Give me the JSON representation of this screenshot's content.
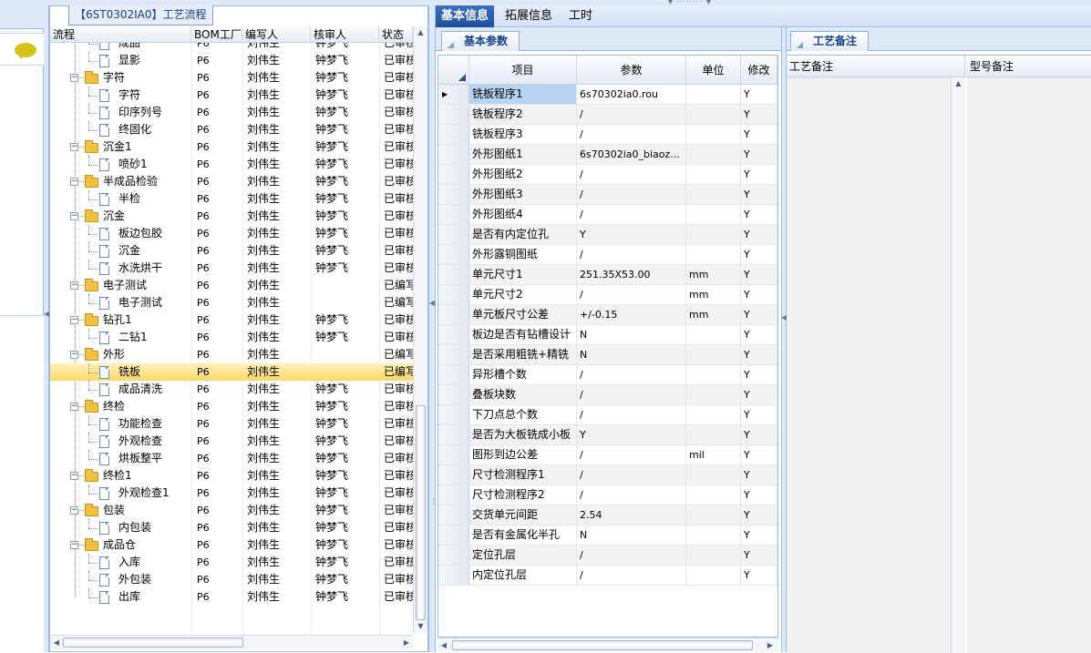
{
  "tree": {
    "title": "【6ST0302IA0】工艺流程",
    "columns": [
      "流程",
      "BOM工厂",
      "编写人",
      "核审人",
      "状态"
    ],
    "rows": [
      {
        "name": "成品",
        "type": "doc",
        "depth": 2,
        "bom": "P6",
        "writer": "刘伟生",
        "reviewer": "钟梦飞",
        "status": "已审核"
      },
      {
        "name": "显影",
        "type": "doc",
        "depth": 2,
        "bom": "P6",
        "writer": "刘伟生",
        "reviewer": "钟梦飞",
        "status": "已审核"
      },
      {
        "name": "字符",
        "type": "folder",
        "depth": 1,
        "bom": "P6",
        "writer": "刘伟生",
        "reviewer": "钟梦飞",
        "status": "已审核"
      },
      {
        "name": "字符",
        "type": "doc",
        "depth": 2,
        "bom": "P6",
        "writer": "刘伟生",
        "reviewer": "钟梦飞",
        "status": "已审核"
      },
      {
        "name": "印序列号",
        "type": "doc",
        "depth": 2,
        "bom": "P6",
        "writer": "刘伟生",
        "reviewer": "钟梦飞",
        "status": "已审核"
      },
      {
        "name": "终固化",
        "type": "doc",
        "depth": 2,
        "bom": "P6",
        "writer": "刘伟生",
        "reviewer": "钟梦飞",
        "status": "已审核"
      },
      {
        "name": "沉金1",
        "type": "folder",
        "depth": 1,
        "bom": "P6",
        "writer": "刘伟生",
        "reviewer": "钟梦飞",
        "status": "已审核"
      },
      {
        "name": "喷砂1",
        "type": "doc",
        "depth": 2,
        "bom": "P6",
        "writer": "刘伟生",
        "reviewer": "钟梦飞",
        "status": "已审核"
      },
      {
        "name": "半成品检验",
        "type": "folder",
        "depth": 1,
        "bom": "P6",
        "writer": "刘伟生",
        "reviewer": "钟梦飞",
        "status": "已审核"
      },
      {
        "name": "半检",
        "type": "doc",
        "depth": 2,
        "bom": "P6",
        "writer": "刘伟生",
        "reviewer": "钟梦飞",
        "status": "已审核"
      },
      {
        "name": "沉金",
        "type": "folder",
        "depth": 1,
        "bom": "P6",
        "writer": "刘伟生",
        "reviewer": "钟梦飞",
        "status": "已审核"
      },
      {
        "name": "板边包胶",
        "type": "doc",
        "depth": 2,
        "bom": "P6",
        "writer": "刘伟生",
        "reviewer": "钟梦飞",
        "status": "已审核"
      },
      {
        "name": "沉金",
        "type": "doc",
        "depth": 2,
        "bom": "P6",
        "writer": "刘伟生",
        "reviewer": "钟梦飞",
        "status": "已审核"
      },
      {
        "name": "水洗烘干",
        "type": "doc",
        "depth": 2,
        "bom": "P6",
        "writer": "刘伟生",
        "reviewer": "钟梦飞",
        "status": "已审核"
      },
      {
        "name": "电子测试",
        "type": "folder",
        "depth": 1,
        "bom": "P6",
        "writer": "刘伟生",
        "reviewer": "",
        "status": "已编写"
      },
      {
        "name": "电子测试",
        "type": "doc",
        "depth": 2,
        "bom": "P6",
        "writer": "刘伟生",
        "reviewer": "",
        "status": "已编写"
      },
      {
        "name": "钻孔1",
        "type": "folder",
        "depth": 1,
        "bom": "P6",
        "writer": "刘伟生",
        "reviewer": "钟梦飞",
        "status": "已审核"
      },
      {
        "name": "二钻1",
        "type": "doc",
        "depth": 2,
        "bom": "P6",
        "writer": "刘伟生",
        "reviewer": "钟梦飞",
        "status": "已审核"
      },
      {
        "name": "外形",
        "type": "folder",
        "depth": 1,
        "bom": "P6",
        "writer": "刘伟生",
        "reviewer": "",
        "status": "已编写"
      },
      {
        "name": "铣板",
        "type": "doc",
        "depth": 2,
        "bom": "P6",
        "writer": "刘伟生",
        "reviewer": "",
        "status": "已编写",
        "selected": true
      },
      {
        "name": "成品清洗",
        "type": "doc",
        "depth": 2,
        "bom": "P6",
        "writer": "刘伟生",
        "reviewer": "钟梦飞",
        "status": "已审核"
      },
      {
        "name": "终检",
        "type": "folder",
        "depth": 1,
        "bom": "P6",
        "writer": "刘伟生",
        "reviewer": "钟梦飞",
        "status": "已审核"
      },
      {
        "name": "功能检查",
        "type": "doc",
        "depth": 2,
        "bom": "P6",
        "writer": "刘伟生",
        "reviewer": "钟梦飞",
        "status": "已审核"
      },
      {
        "name": "外观检查",
        "type": "doc",
        "depth": 2,
        "bom": "P6",
        "writer": "刘伟生",
        "reviewer": "钟梦飞",
        "status": "已审核"
      },
      {
        "name": "烘板整平",
        "type": "doc",
        "depth": 2,
        "bom": "P6",
        "writer": "刘伟生",
        "reviewer": "钟梦飞",
        "status": "已审核"
      },
      {
        "name": "终检1",
        "type": "folder",
        "depth": 1,
        "bom": "P6",
        "writer": "刘伟生",
        "reviewer": "钟梦飞",
        "status": "已审核"
      },
      {
        "name": "外观检查1",
        "type": "doc",
        "depth": 2,
        "bom": "P6",
        "writer": "刘伟生",
        "reviewer": "钟梦飞",
        "status": "已审核"
      },
      {
        "name": "包装",
        "type": "folder",
        "depth": 1,
        "bom": "P6",
        "writer": "刘伟生",
        "reviewer": "钟梦飞",
        "status": "已审核"
      },
      {
        "name": "内包装",
        "type": "doc",
        "depth": 2,
        "bom": "P6",
        "writer": "刘伟生",
        "reviewer": "钟梦飞",
        "status": "已审核"
      },
      {
        "name": "成品仓",
        "type": "folder",
        "depth": 1,
        "bom": "P6",
        "writer": "刘伟生",
        "reviewer": "钟梦飞",
        "status": "已审核"
      },
      {
        "name": "入库",
        "type": "doc",
        "depth": 2,
        "bom": "P6",
        "writer": "刘伟生",
        "reviewer": "钟梦飞",
        "status": "已审核"
      },
      {
        "name": "外包装",
        "type": "doc",
        "depth": 2,
        "bom": "P6",
        "writer": "刘伟生",
        "reviewer": "钟梦飞",
        "status": "已审核"
      },
      {
        "name": "出库",
        "type": "doc",
        "depth": 2,
        "bom": "P6",
        "writer": "刘伟生",
        "reviewer": "钟梦飞",
        "status": "已审核"
      }
    ]
  },
  "main_tabs": [
    "基本信息",
    "拓展信息",
    "工时"
  ],
  "params": {
    "tab_label": "基本参数",
    "columns": [
      "项目",
      "参数",
      "单位",
      "修改"
    ],
    "rows": [
      {
        "item": "铣板程序1",
        "value": "6s70302ia0.rou",
        "unit": "",
        "mod": "Y",
        "selected": true
      },
      {
        "item": "铣板程序2",
        "value": "/",
        "unit": "",
        "mod": "Y"
      },
      {
        "item": "铣板程序3",
        "value": "/",
        "unit": "",
        "mod": "Y"
      },
      {
        "item": "外形图纸1",
        "value": "6s70302ia0_biaoz...",
        "unit": "",
        "mod": "Y"
      },
      {
        "item": "外形图纸2",
        "value": "/",
        "unit": "",
        "mod": "Y"
      },
      {
        "item": "外形图纸3",
        "value": "/",
        "unit": "",
        "mod": "Y"
      },
      {
        "item": "外形图纸4",
        "value": "/",
        "unit": "",
        "mod": "Y"
      },
      {
        "item": "是否有内定位孔",
        "value": "Y",
        "unit": "",
        "mod": "Y"
      },
      {
        "item": "外形露铜图纸",
        "value": "/",
        "unit": "",
        "mod": "Y"
      },
      {
        "item": "单元尺寸1",
        "value": "251.35X53.00",
        "unit": "mm",
        "mod": "Y"
      },
      {
        "item": "单元尺寸2",
        "value": "/",
        "unit": "mm",
        "mod": "Y"
      },
      {
        "item": "单元板尺寸公差",
        "value": "+/-0.15",
        "unit": "mm",
        "mod": "Y"
      },
      {
        "item": "板边是否有钻槽设计",
        "value": "N",
        "unit": "",
        "mod": "Y"
      },
      {
        "item": "是否采用粗铣+精铣",
        "value": "N",
        "unit": "",
        "mod": "Y"
      },
      {
        "item": "异形槽个数",
        "value": "/",
        "unit": "",
        "mod": "Y"
      },
      {
        "item": "叠板块数",
        "value": "/",
        "unit": "",
        "mod": "Y"
      },
      {
        "item": "下刀点总个数",
        "value": "/",
        "unit": "",
        "mod": "Y"
      },
      {
        "item": "是否为大板铣成小板",
        "value": "Y",
        "unit": "",
        "mod": "Y"
      },
      {
        "item": "图形到边公差",
        "value": "/",
        "unit": "mil",
        "mod": "Y"
      },
      {
        "item": "尺寸检测程序1",
        "value": "/",
        "unit": "",
        "mod": "Y"
      },
      {
        "item": "尺寸检测程序2",
        "value": "/",
        "unit": "",
        "mod": "Y"
      },
      {
        "item": "交货单元间距",
        "value": "2.54",
        "unit": "",
        "mod": "Y"
      },
      {
        "item": "是否有金属化半孔",
        "value": "N",
        "unit": "",
        "mod": "Y"
      },
      {
        "item": "定位孔层",
        "value": "/",
        "unit": "",
        "mod": "Y"
      },
      {
        "item": "内定位孔层",
        "value": "/",
        "unit": "",
        "mod": "Y"
      }
    ]
  },
  "notes": {
    "tab_label": "工艺备注",
    "columns": [
      "工艺备注",
      "型号备注"
    ]
  },
  "icons": {
    "chat": "speech-bubble-icon",
    "folder": "folder-icon",
    "doc": "document-icon"
  }
}
